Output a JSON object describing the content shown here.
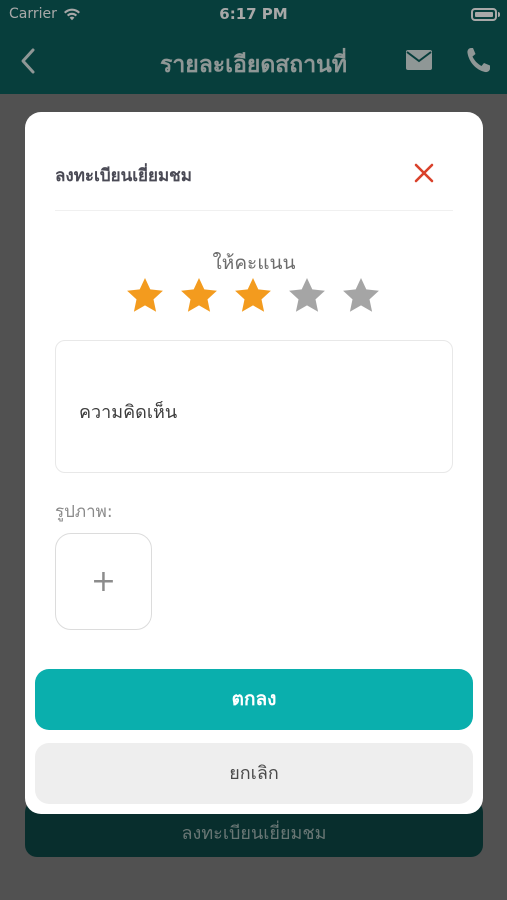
{
  "status_bar": {
    "carrier": "Carrier",
    "time": "6:17 PM",
    "icons": [
      "wifi-icon",
      "battery-icon"
    ]
  },
  "nav_bar": {
    "title": "รายละเอียดสถานที่",
    "icons": [
      "chevron-left-icon",
      "mail-icon",
      "phone-icon"
    ],
    "color": "#0b5f5b"
  },
  "page": {
    "register_button_label": "ลงทะเบียนเยี่ยมชม"
  },
  "modal": {
    "title": "ลงทะเบียนเยี่ยมชม",
    "close_icon": "close-icon",
    "rating": {
      "label": "ให้คะแนน",
      "value": 3,
      "max": 5,
      "active_color": "#f39b1e",
      "inactive_color": "#a5a5a5"
    },
    "comment": {
      "placeholder": "ความคิดเห็น",
      "value": ""
    },
    "photos": {
      "label": "รูปภาพ:",
      "add_icon": "plus-icon"
    },
    "buttons": {
      "confirm_label": "ตกลง",
      "confirm_color": "#0aafad",
      "cancel_label": "ยกเลิก"
    }
  }
}
